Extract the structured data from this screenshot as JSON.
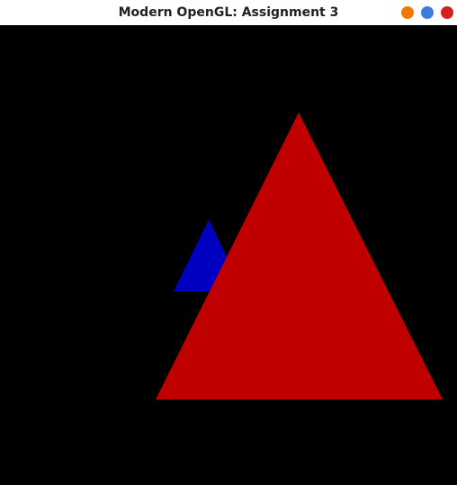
{
  "window": {
    "title": "Modern OpenGL: Assignment 3",
    "controls": [
      {
        "name": "minimize-button",
        "icon": "minimize-icon",
        "color": "#f57900"
      },
      {
        "name": "maximize-button",
        "icon": "maximize-icon",
        "color": "#3d7be0"
      },
      {
        "name": "close-button",
        "icon": "close-icon",
        "color": "#d32020"
      }
    ]
  },
  "scene": {
    "background": "#000000",
    "shapes": [
      {
        "name": "blue-triangle",
        "color": "#0000c0"
      },
      {
        "name": "red-triangle",
        "color": "#c00000"
      }
    ]
  }
}
